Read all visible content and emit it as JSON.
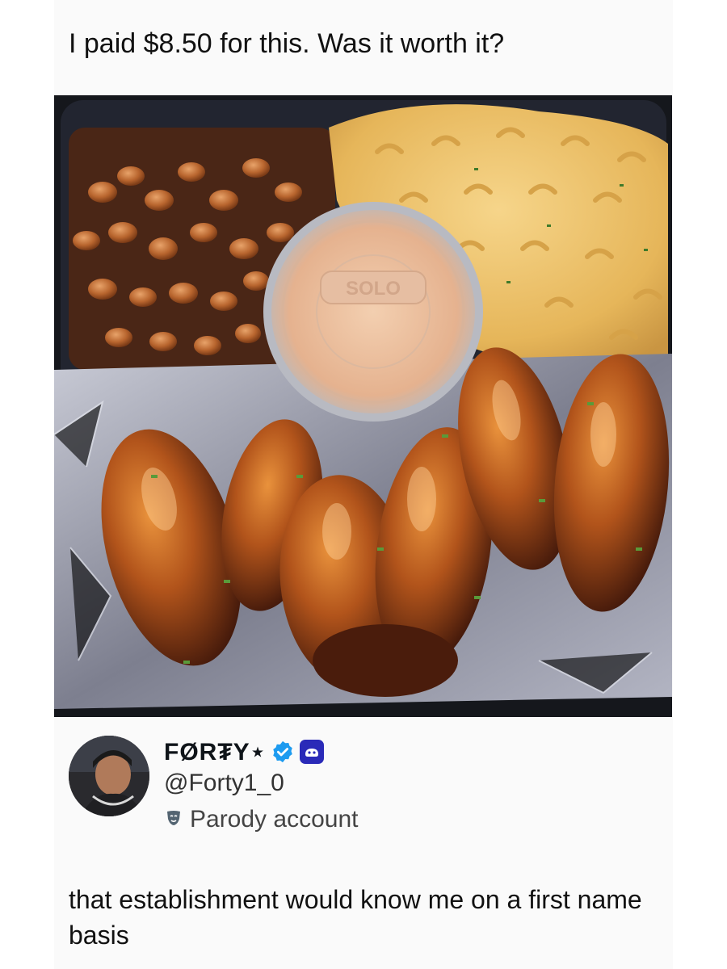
{
  "post": {
    "text": "I paid $8.50 for this. Was it worth it?"
  },
  "media": {
    "description_icon": "food-photo",
    "cup_lid_text": "SOLO"
  },
  "reply": {
    "display_name": "FØR₮Y⋆",
    "handle": "@Forty1_0",
    "badge_label": "Parody account",
    "verified_icon": "verified-badge-icon",
    "game_icon": "game-badge-icon",
    "mask_icon": "theater-mask-icon",
    "text": "that establishment would know me on a first name basis"
  },
  "colors": {
    "verified": "#1d9bf0",
    "game_badge": "#2a2ab8",
    "text": "#0f1419"
  }
}
